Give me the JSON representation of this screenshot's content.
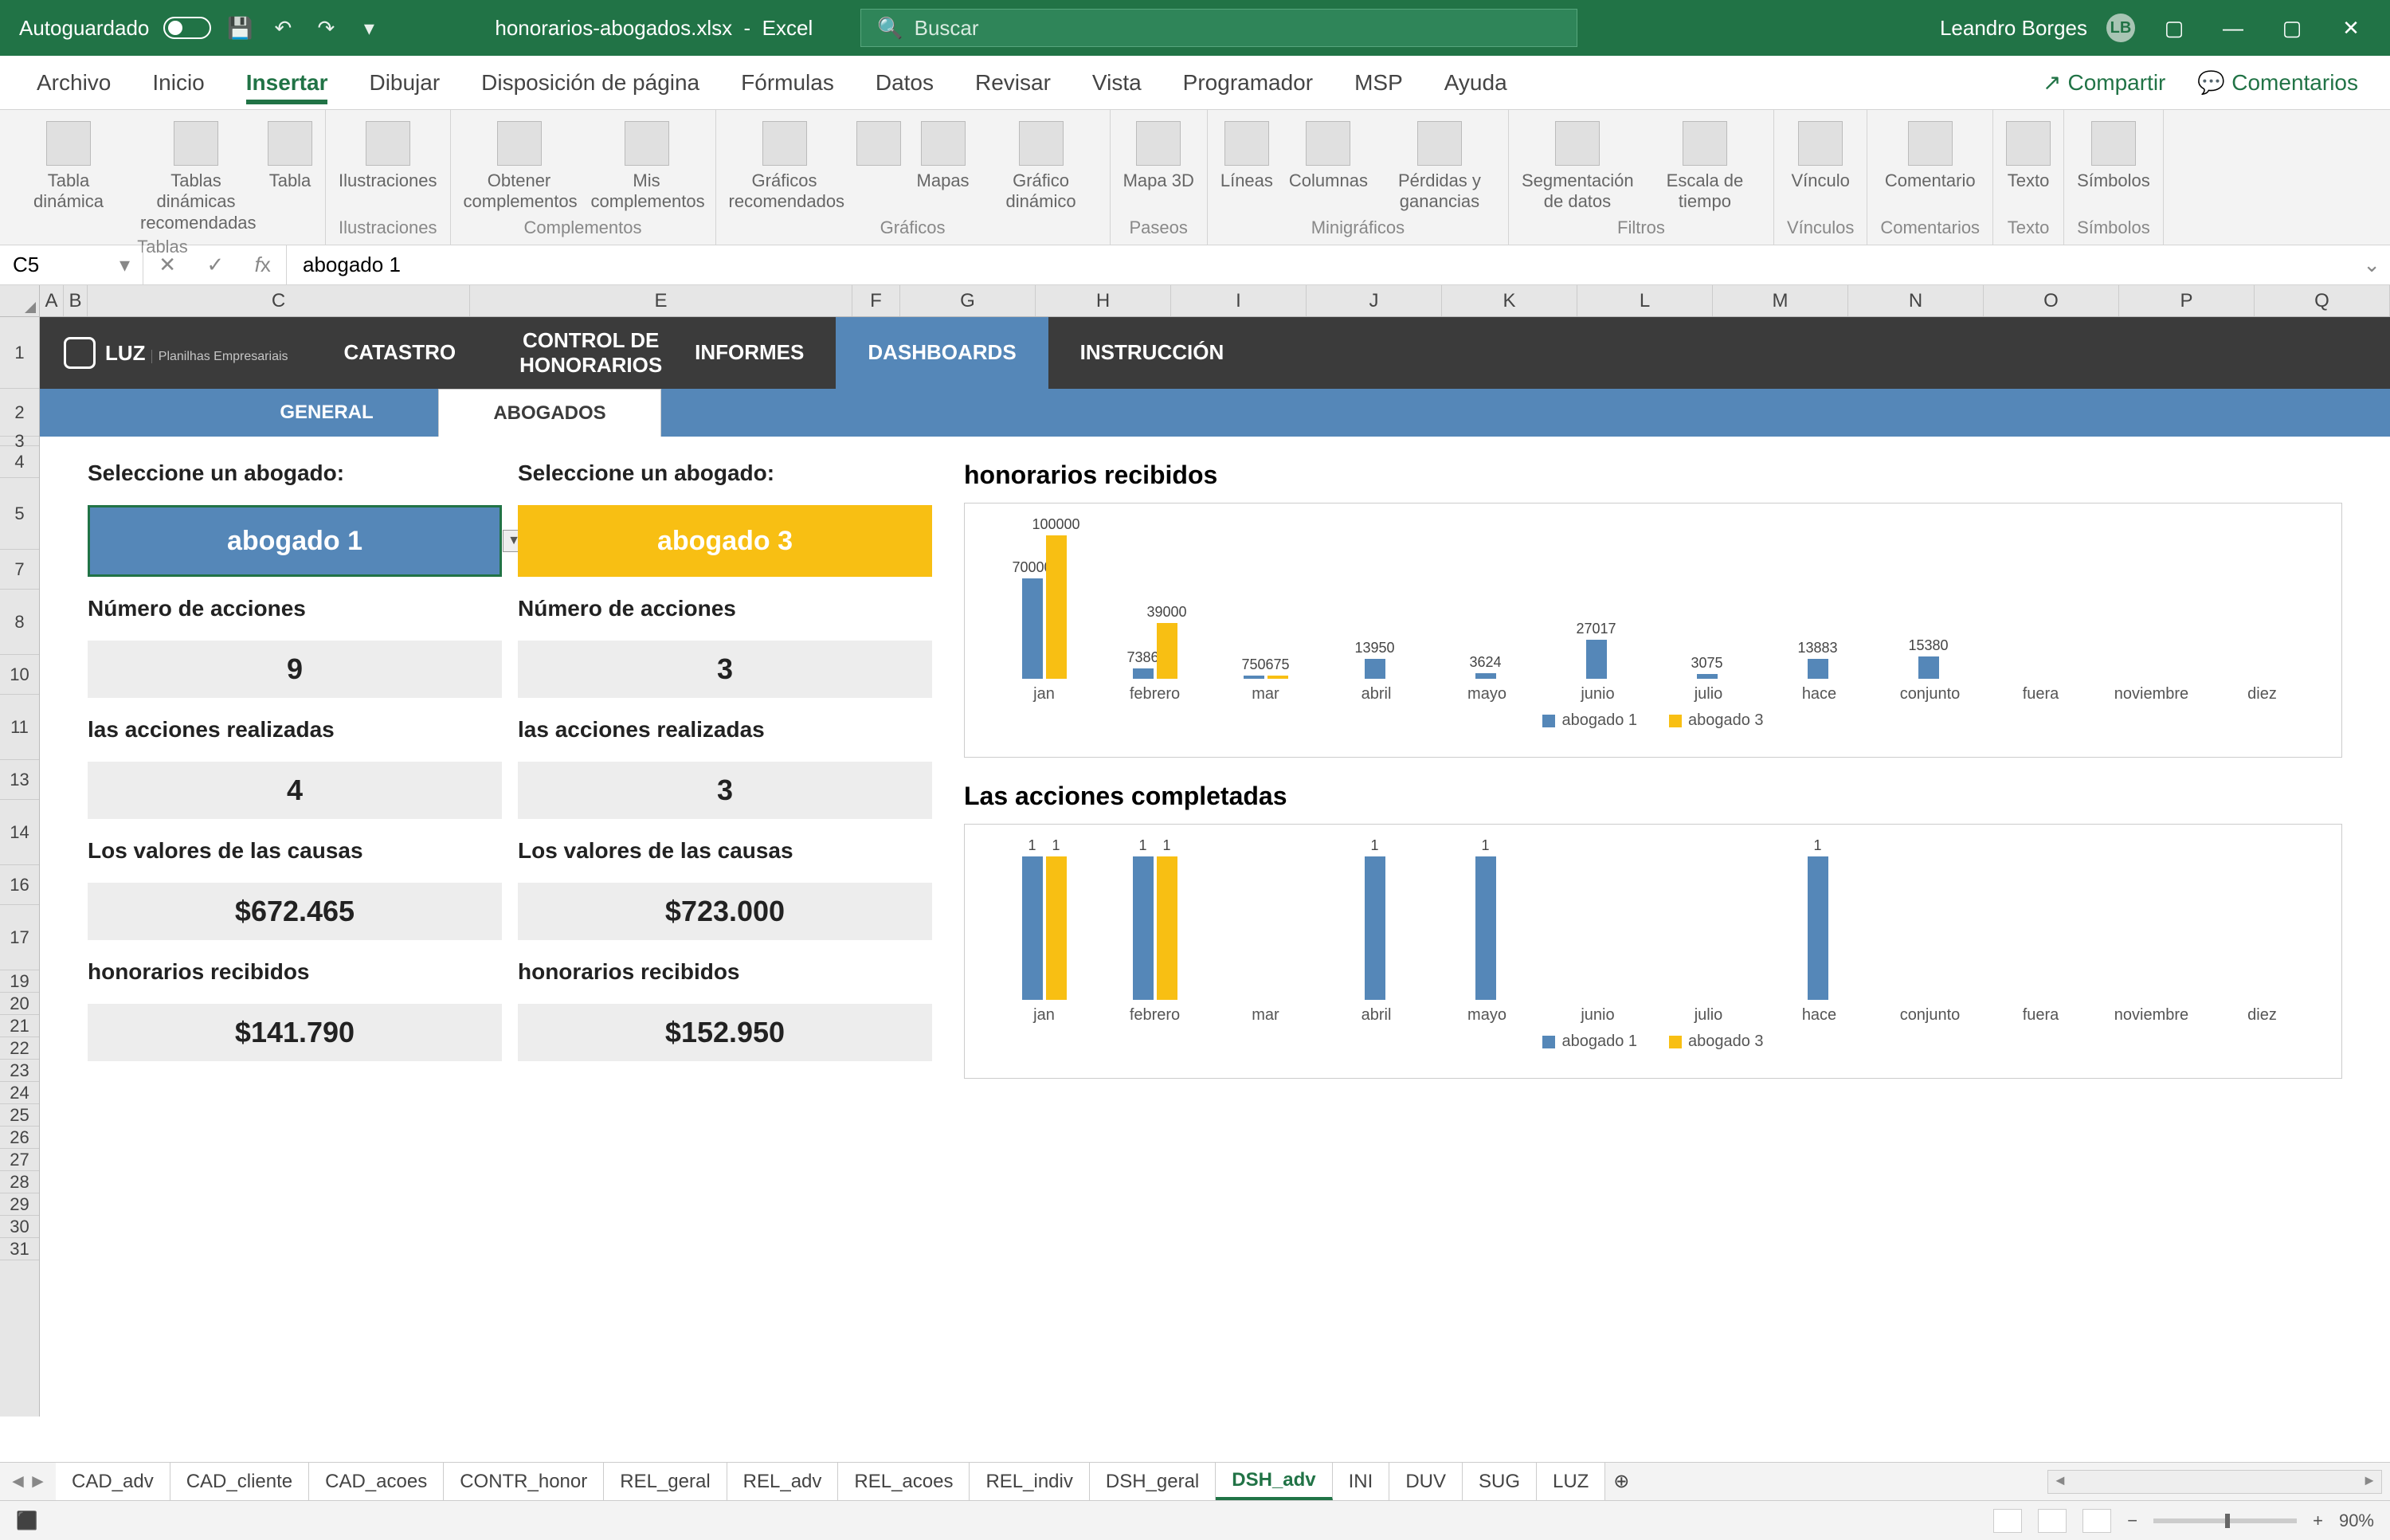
{
  "titlebar": {
    "autosave": "Autoguardado",
    "filename": "honorarios-abogados.xlsx",
    "app_suffix": "Excel",
    "search_placeholder": "Buscar",
    "username": "Leandro Borges",
    "user_initials": "LB"
  },
  "menu": {
    "tabs": [
      "Archivo",
      "Inicio",
      "Insertar",
      "Dibujar",
      "Disposición de página",
      "Fórmulas",
      "Datos",
      "Revisar",
      "Vista",
      "Programador",
      "MSP",
      "Ayuda"
    ],
    "active": "Insertar",
    "share": "Compartir",
    "comments": "Comentarios"
  },
  "ribbon": {
    "groups": [
      {
        "label": "Tablas",
        "items": [
          "Tabla dinámica",
          "Tablas dinámicas recomendadas",
          "Tabla"
        ]
      },
      {
        "label": "Ilustraciones",
        "items": [
          "Ilustraciones"
        ]
      },
      {
        "label": "Complementos",
        "items": [
          "Obtener complementos",
          "Mis complementos"
        ]
      },
      {
        "label": "Gráficos",
        "items": [
          "Gráficos recomendados",
          "",
          "Mapas",
          "Gráfico dinámico"
        ]
      },
      {
        "label": "Paseos",
        "items": [
          "Mapa 3D"
        ]
      },
      {
        "label": "Minigráficos",
        "items": [
          "Líneas",
          "Columnas",
          "Pérdidas y ganancias"
        ]
      },
      {
        "label": "Filtros",
        "items": [
          "Segmentación de datos",
          "Escala de tiempo"
        ]
      },
      {
        "label": "Vínculos",
        "items": [
          "Vínculo"
        ]
      },
      {
        "label": "Comentarios",
        "items": [
          "Comentario"
        ]
      },
      {
        "label": "Texto",
        "items": [
          "Texto"
        ]
      },
      {
        "label": "Símbolos",
        "items": [
          "Símbolos"
        ]
      }
    ]
  },
  "formula": {
    "cell": "C5",
    "value": "abogado 1"
  },
  "columns": [
    "A",
    "B",
    "C",
    "E",
    "F",
    "G",
    "H",
    "I",
    "J",
    "K",
    "L",
    "M",
    "N",
    "O",
    "P",
    "Q"
  ],
  "rows": [
    "1",
    "2",
    "3",
    "4",
    "5",
    "7",
    "8",
    "10",
    "11",
    "13",
    "14",
    "16",
    "17",
    "19",
    "20",
    "21",
    "22",
    "23",
    "24",
    "25",
    "26",
    "27",
    "28",
    "29",
    "30",
    "31"
  ],
  "dashboard": {
    "logo_main": "LUZ",
    "logo_sub": "Planilhas Empresariais",
    "nav": [
      "CATASTRO",
      "CONTROL DE HONORARIOS",
      "INFORMES",
      "DASHBOARDS",
      "INSTRUCCIÓN"
    ],
    "nav_active": "DASHBOARDS",
    "subnav": [
      "GENERAL",
      "ABOGADOS"
    ],
    "subnav_active": "ABOGADOS",
    "select_label": "Seleccione un abogado:",
    "lawyer1": {
      "name": "abogado 1",
      "num_acciones_label": "Número de acciones",
      "num_acciones": "9",
      "realizadas_label": "las acciones realizadas",
      "realizadas": "4",
      "valores_label": "Los valores de las causas",
      "valores": "$672.465",
      "honorarios_label": "honorarios recibidos",
      "honorarios": "$141.790"
    },
    "lawyer2": {
      "name": "abogado 3",
      "num_acciones_label": "Número de acciones",
      "num_acciones": "3",
      "realizadas_label": "las acciones realizadas",
      "realizadas": "3",
      "valores_label": "Los valores de las causas",
      "valores": "$723.000",
      "honorarios_label": "honorarios recibidos",
      "honorarios": "$152.950"
    }
  },
  "chart_data": [
    {
      "type": "bar",
      "title": "honorarios recibidos",
      "categories": [
        "jan",
        "febrero",
        "mar",
        "abril",
        "mayo",
        "junio",
        "julio",
        "hace",
        "conjunto",
        "fuera",
        "noviembre",
        "diez"
      ],
      "series": [
        {
          "name": "abogado 1",
          "values": [
            70000,
            7386,
            750,
            13950,
            3624,
            27017,
            3075,
            13883,
            15380,
            null,
            null,
            null
          ]
        },
        {
          "name": "abogado 3",
          "values": [
            100000,
            39000,
            675,
            null,
            null,
            null,
            null,
            null,
            null,
            null,
            null,
            null
          ]
        }
      ],
      "ymax": 100000
    },
    {
      "type": "bar",
      "title": "Las acciones completadas",
      "categories": [
        "jan",
        "febrero",
        "mar",
        "abril",
        "mayo",
        "junio",
        "julio",
        "hace",
        "conjunto",
        "fuera",
        "noviembre",
        "diez"
      ],
      "series": [
        {
          "name": "abogado 1",
          "values": [
            1,
            1,
            null,
            1,
            1,
            null,
            null,
            1,
            null,
            null,
            null,
            null
          ]
        },
        {
          "name": "abogado 3",
          "values": [
            1,
            1,
            null,
            null,
            null,
            null,
            null,
            null,
            null,
            null,
            null,
            null
          ]
        }
      ],
      "ymax": 1
    }
  ],
  "sheets": [
    "CAD_adv",
    "CAD_cliente",
    "CAD_acoes",
    "CONTR_honor",
    "REL_geral",
    "REL_adv",
    "REL_acoes",
    "REL_indiv",
    "DSH_geral",
    "DSH_adv",
    "INI",
    "DUV",
    "SUG",
    "LUZ"
  ],
  "active_sheet": "DSH_adv",
  "statusbar": {
    "zoom": "90%"
  }
}
